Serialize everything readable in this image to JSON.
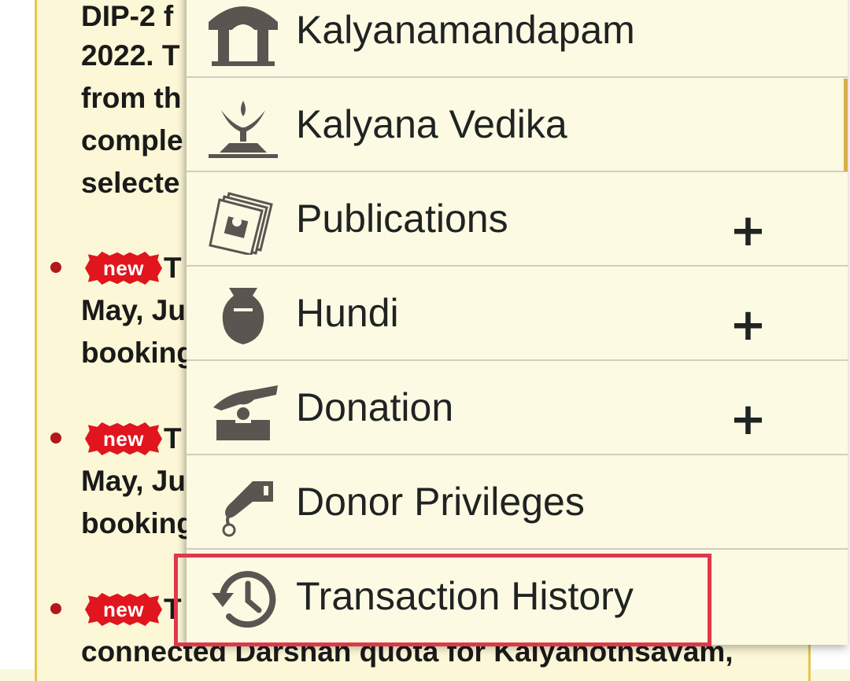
{
  "background": {
    "lines": [
      "DIP-2 f",
      "2022. T",
      "from th",
      "comple",
      "selecte"
    ],
    "news": [
      {
        "badge": "new",
        "after": "T",
        "lines": [
          "May, Ju",
          "booking"
        ]
      },
      {
        "badge": "new",
        "after": "T",
        "lines": [
          "May, Ju",
          "booking"
        ]
      },
      {
        "badge": "new",
        "after": "T",
        "lines": [
          "connected Darshan quota for Kalyanothsavam,"
        ]
      }
    ]
  },
  "menu": {
    "items": [
      {
        "label": "Kalyanamandapam",
        "icon": "mandapam-icon",
        "expandable": false
      },
      {
        "label": "Kalyana Vedika",
        "icon": "vedika-icon",
        "expandable": false
      },
      {
        "label": "Publications",
        "icon": "publications-icon",
        "expandable": true,
        "expand_symbol": "+"
      },
      {
        "label": "Hundi",
        "icon": "hundi-pot-icon",
        "expandable": true,
        "expand_symbol": "+"
      },
      {
        "label": "Donation",
        "icon": "donation-hand-icon",
        "expandable": true,
        "expand_symbol": "+"
      },
      {
        "label": "Donor Privileges",
        "icon": "donor-privileges-icon",
        "expandable": false
      },
      {
        "label": "Transaction History",
        "icon": "history-clock-icon",
        "expandable": false,
        "highlighted": true
      }
    ]
  },
  "colors": {
    "menu_bg": "#fdfae4",
    "page_panel_bg": "#fcf7d6",
    "highlight": "#e0384a",
    "bullet": "#b3181c",
    "new_badge": "#e0151d",
    "icon": "#5a5550"
  }
}
